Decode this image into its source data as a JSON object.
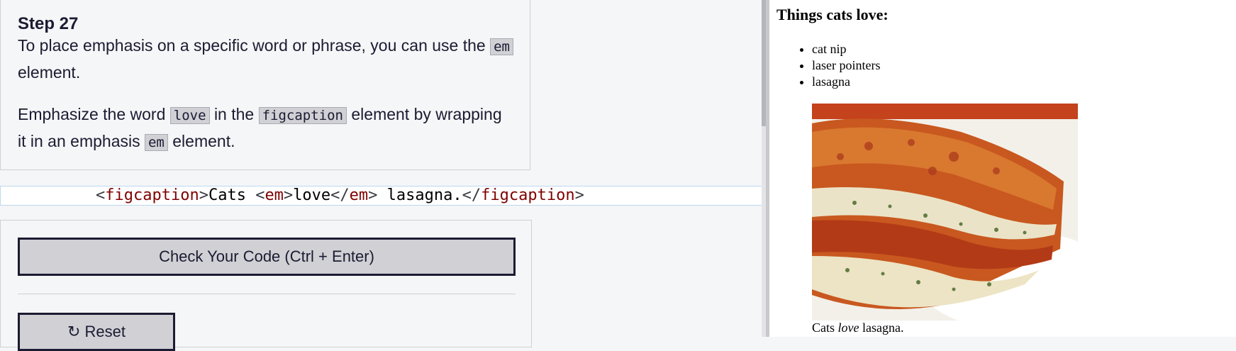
{
  "step": {
    "title": "Step 27",
    "p1_before": "To place emphasis on a specific word or phrase, you can use the",
    "p1_code": "em",
    "p1_after": "element.",
    "p2_part1": "Emphasize the word",
    "p2_code1": "love",
    "p2_part2": "in the",
    "p2_code2": "figcaption",
    "p2_part3": "element by wrapping it in an emphasis",
    "p2_code3": "em",
    "p2_part4": "element."
  },
  "editor": {
    "line": {
      "open_lt": "<",
      "tag1": "figcaption",
      "gt1": ">",
      "text1": "Cats ",
      "lt2": "<",
      "tag2": "em",
      "gt2": ">",
      "text2": "love",
      "lt3": "</",
      "tag3": "em",
      "gt3": ">",
      "text3": " lasagna.",
      "lt4": "</",
      "tag4": "figcaption",
      "gt4": ">"
    }
  },
  "actions": {
    "check_label": "Check Your Code (Ctrl + Enter)",
    "reset_label": "Reset",
    "reset_icon": "reset-icon"
  },
  "preview": {
    "heading": "Things cats love:",
    "items": [
      "cat nip",
      "laser pointers",
      "lasagna"
    ],
    "caption_before": "Cats ",
    "caption_em": "love",
    "caption_after": " lasagna."
  },
  "colors": {
    "tag": "#800000",
    "panel_bg": "#f5f6f7",
    "button_bg": "#d0d0d5",
    "text": "#1b1b32"
  }
}
